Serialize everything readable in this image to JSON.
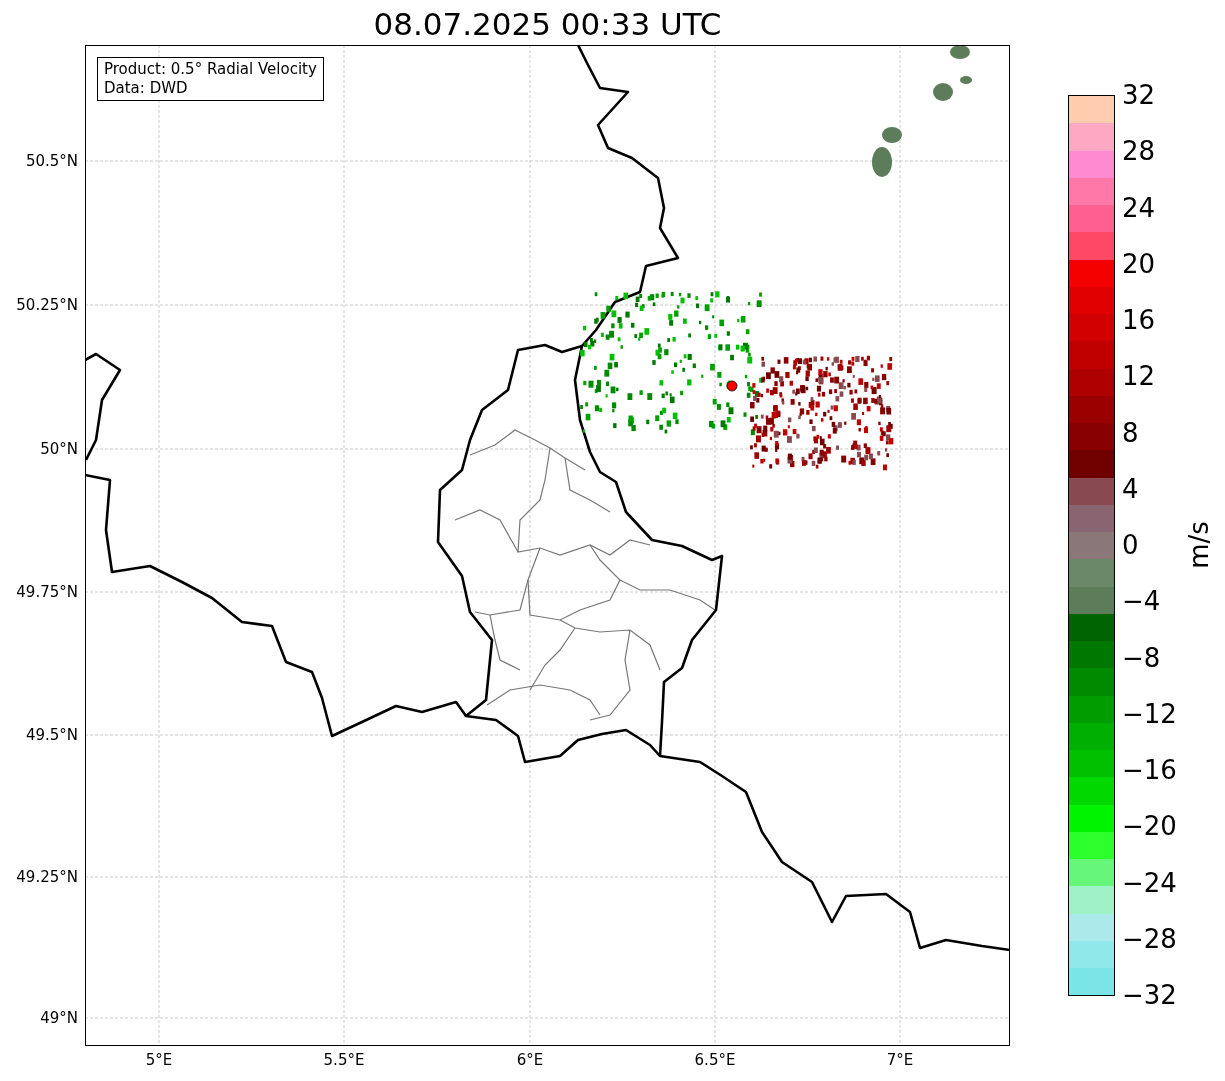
{
  "title": "08.07.2025 00:33 UTC",
  "info_box": {
    "lines": [
      "Product: 0.5° Radial Velocity",
      "Data: DWD"
    ]
  },
  "y_ticks": [
    "50.5°N",
    "50.25°N",
    "50°N",
    "49.75°N",
    "49.5°N",
    "49.25°N",
    "49°N"
  ],
  "x_ticks": [
    "5°E",
    "5.5°E",
    "6°E",
    "6.5°E",
    "7°E"
  ],
  "colorbar": {
    "label": "m/s",
    "ticks": [
      "32",
      "28",
      "24",
      "20",
      "16",
      "12",
      "8",
      "4",
      "0",
      "−4",
      "−8",
      "−12",
      "−16",
      "−20",
      "−24",
      "−28",
      "−32"
    ],
    "bands": [
      {
        "color": "#ffccb0"
      },
      {
        "color": "#ffa8c4"
      },
      {
        "color": "#ff8ad2"
      },
      {
        "color": "#ff78a8"
      },
      {
        "color": "#ff6090"
      },
      {
        "color": "#ff4866"
      },
      {
        "color": "#f50000"
      },
      {
        "color": "#e00000"
      },
      {
        "color": "#d20000"
      },
      {
        "color": "#c00000"
      },
      {
        "color": "#ae0000"
      },
      {
        "color": "#9a0000"
      },
      {
        "color": "#880000"
      },
      {
        "color": "#700000"
      },
      {
        "color": "#884a50"
      },
      {
        "color": "#8a6470"
      },
      {
        "color": "#8a7878"
      },
      {
        "color": "#6a8868"
      },
      {
        "color": "#5c7c5a"
      },
      {
        "color": "#006400"
      },
      {
        "color": "#007800"
      },
      {
        "color": "#008a00"
      },
      {
        "color": "#009c00"
      },
      {
        "color": "#00b000"
      },
      {
        "color": "#00c000"
      },
      {
        "color": "#00d800"
      },
      {
        "color": "#00f400"
      },
      {
        "color": "#2cff2c"
      },
      {
        "color": "#66f77a"
      },
      {
        "color": "#9ef2c6"
      },
      {
        "color": "#ace9ea"
      },
      {
        "color": "#90e8ea"
      },
      {
        "color": "#7ae4e6"
      }
    ]
  }
}
